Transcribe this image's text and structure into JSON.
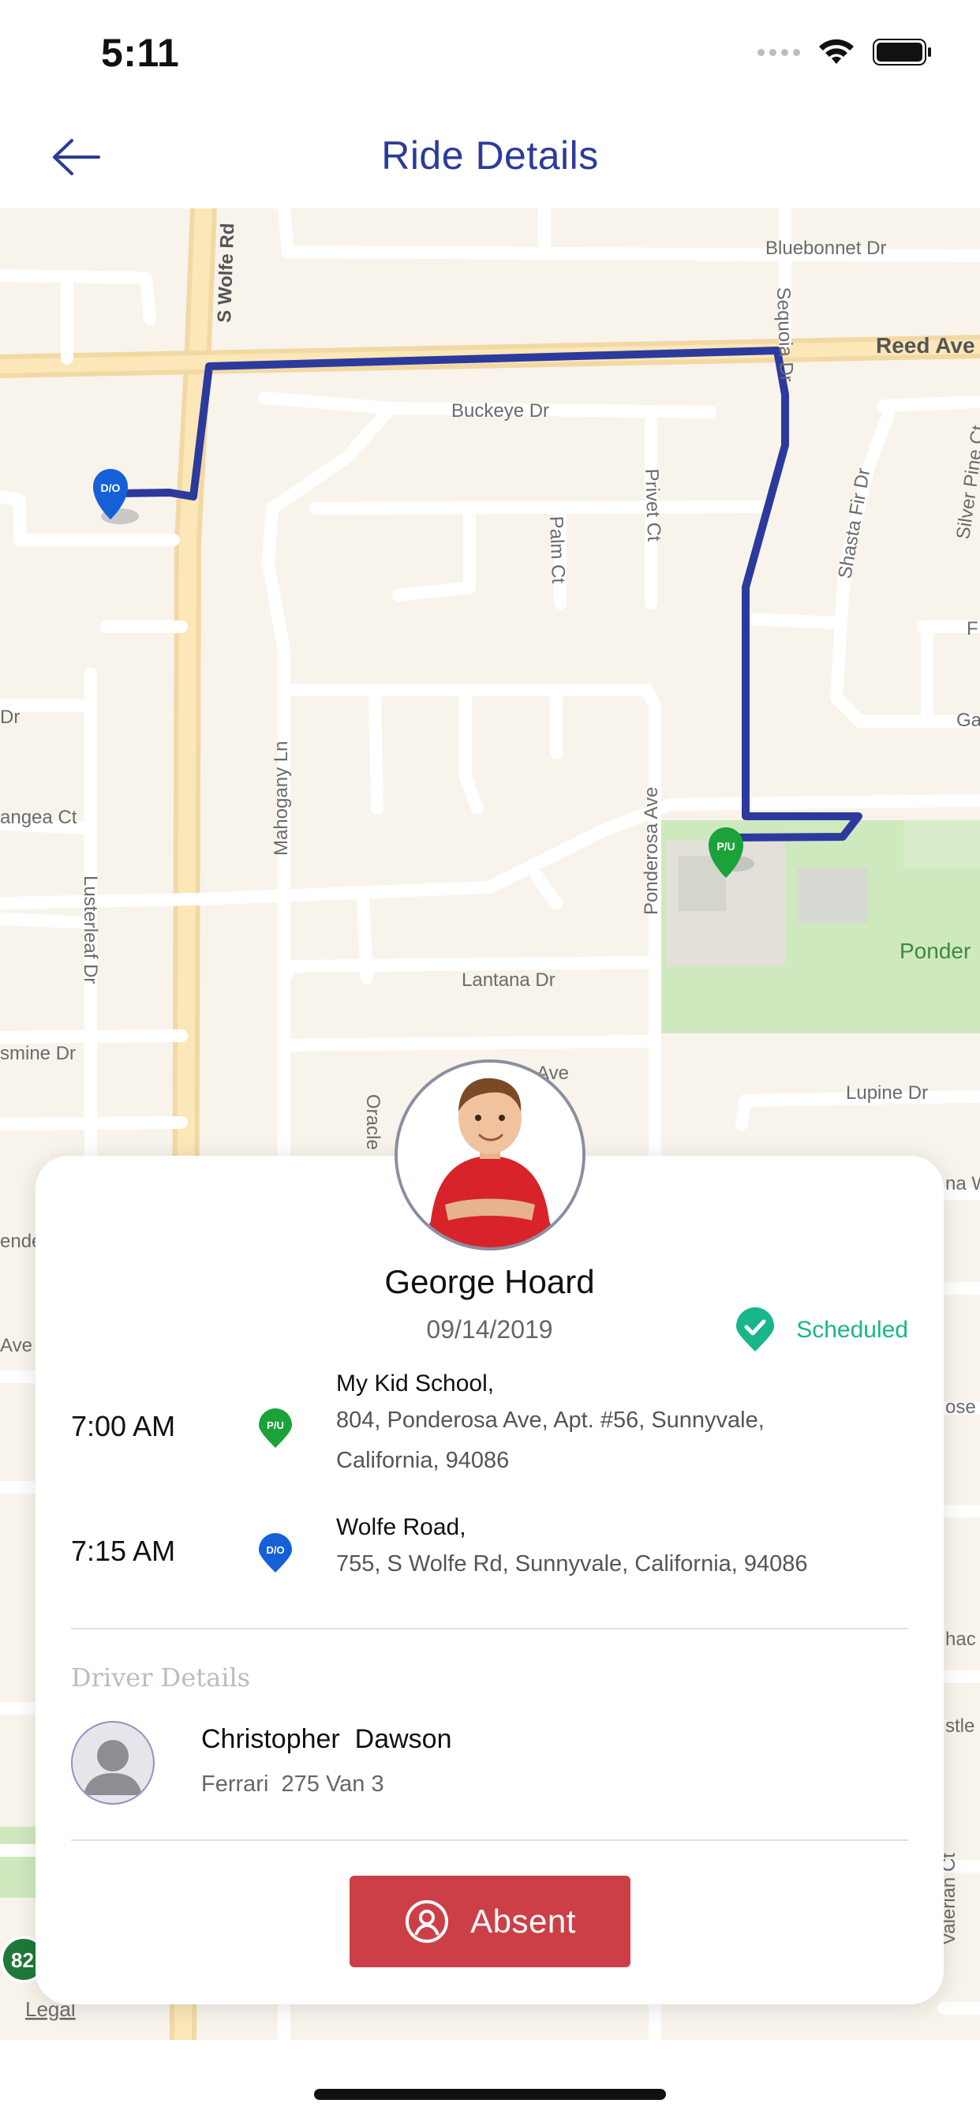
{
  "status_bar": {
    "time": "5:11"
  },
  "nav": {
    "title": "Ride Details",
    "back_icon": "arrow-left-icon"
  },
  "map": {
    "street_labels": [
      "Bluebonnet Dr",
      "Reed Ave",
      "S Wolfe Rd",
      "Sequoia Dr",
      "Buckeye Dr",
      "Privet Ct",
      "Palm Ct",
      "Shasta Fir Dr",
      "Silver Pine Ct",
      "Dr",
      "angea Ct",
      "Mahogany Ln",
      "Ponderosa Ave",
      "Lusterleaf Dr",
      "Lantana Dr",
      "Ave",
      "smine Dr",
      "Lupine Dr",
      "Ponder",
      "Oracle",
      "Legal",
      "82",
      "Valerian Ct",
      "F",
      "Ga",
      "ende",
      "Ave",
      "ose A",
      "hac",
      "stle",
      "na W"
    ],
    "pickup_marker": "P/U",
    "dropoff_marker": "D/O",
    "route_color": "#2c3a9e"
  },
  "ride": {
    "student_name": "George Hoard",
    "date": "09/14/2019",
    "status": "Scheduled",
    "status_color": "#18b68a",
    "stops": [
      {
        "time": "7:00 AM",
        "type": "P/U",
        "pin_color": "#1ba33a",
        "name": "My Kid School,",
        "address_line1": "804, Ponderosa Ave, Apt. #56, Sunnyvale,",
        "address_line2": "California, 94086"
      },
      {
        "time": "7:15 AM",
        "type": "D/O",
        "pin_color": "#1560d9",
        "name": "Wolfe Road,",
        "address_line1": "755, S Wolfe Rd, Sunnyvale, California, 94086"
      }
    ]
  },
  "driver": {
    "header": "Driver Details",
    "name": "Christopher  Dawson",
    "vehicle": "Ferrari  275 Van 3"
  },
  "actions": {
    "absent_label": "Absent",
    "absent_color": "#cd3f47"
  }
}
